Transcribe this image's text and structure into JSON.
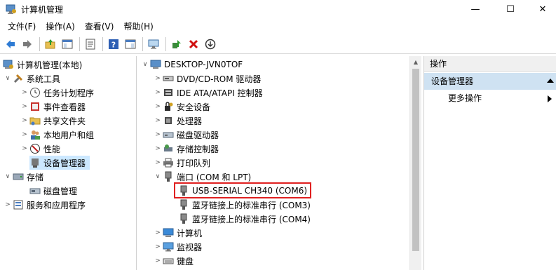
{
  "window": {
    "title": "计算机管理",
    "minimize_glyph": "—",
    "maximize_glyph": "☐",
    "close_glyph": "✕"
  },
  "menu": [
    {
      "label": "文件(F)"
    },
    {
      "label": "操作(A)"
    },
    {
      "label": "查看(V)"
    },
    {
      "label": "帮助(H)"
    }
  ],
  "toolbar": {
    "buttons": [
      {
        "icon": "back-arrow-icon"
      },
      {
        "icon": "forward-arrow-icon"
      },
      {
        "icon": "up-folder-icon"
      },
      {
        "icon": "show-hide-tree-icon"
      },
      {
        "icon": "properties-icon"
      },
      {
        "icon": "help-icon"
      },
      {
        "icon": "show-hide-action-pane-icon"
      },
      {
        "icon": "monitor-icon"
      },
      {
        "icon": "update-driver-icon"
      },
      {
        "icon": "uninstall-x-icon"
      },
      {
        "icon": "download-circle-icon"
      }
    ],
    "uninstall_color": "#d01010"
  },
  "left_tree": {
    "root": "计算机管理(本地)",
    "system_tools": "系统工具",
    "items": [
      {
        "label": "任务计划程序"
      },
      {
        "label": "事件查看器"
      },
      {
        "label": "共享文件夹"
      },
      {
        "label": "本地用户和组"
      },
      {
        "label": "性能"
      },
      {
        "label": "设备管理器"
      }
    ],
    "storage": "存储",
    "disk_mgmt": "磁盘管理",
    "services": "服务和应用程序"
  },
  "device_tree": {
    "computer": "DESKTOP-JVN0TOF",
    "categories": [
      {
        "label": "DVD/CD-ROM 驱动器"
      },
      {
        "label": "IDE ATA/ATAPI 控制器"
      },
      {
        "label": "安全设备"
      },
      {
        "label": "处理器"
      },
      {
        "label": "磁盘驱动器"
      },
      {
        "label": "存储控制器"
      },
      {
        "label": "打印队列"
      },
      {
        "label": "端口 (COM 和 LPT)"
      }
    ],
    "ports": [
      {
        "label": "USB-SERIAL CH340 (COM6)"
      },
      {
        "label": "蓝牙链接上的标准串行 (COM3)"
      },
      {
        "label": "蓝牙链接上的标准串行 (COM4)"
      }
    ],
    "after": [
      {
        "label": "计算机"
      },
      {
        "label": "监视器"
      },
      {
        "label": "键盘"
      }
    ],
    "highlight_color": "#e02020"
  },
  "actions": {
    "header": "操作",
    "section": "设备管理器",
    "more": "更多操作"
  }
}
